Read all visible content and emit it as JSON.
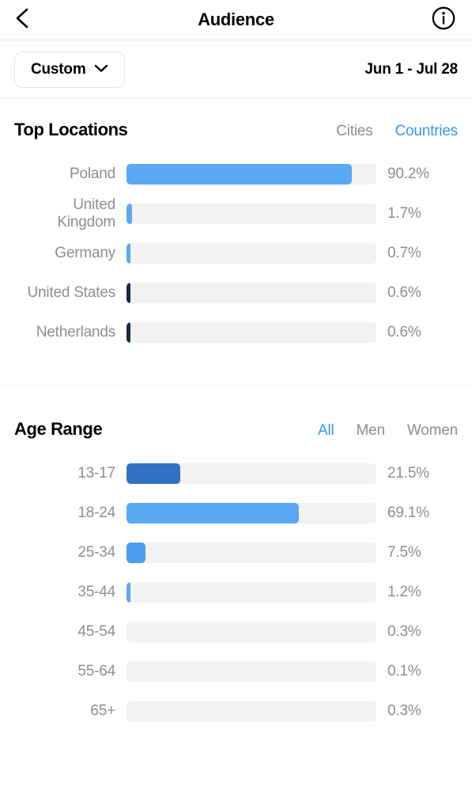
{
  "navbar": {
    "back_icon": "chevron-left-icon",
    "title": "Audience",
    "info_icon": "info-circle-icon"
  },
  "date_bar": {
    "preset_label": "Custom",
    "caret_icon": "chevron-down-icon",
    "range": "Jun 1 - Jul 28"
  },
  "top_locations": {
    "title": "Top Locations",
    "tabs": [
      {
        "label": "Cities",
        "active": false
      },
      {
        "label": "Countries",
        "active": true
      }
    ]
  },
  "age_range": {
    "title": "Age Range",
    "tabs": [
      {
        "label": "All",
        "active": true
      },
      {
        "label": "Men",
        "active": false
      },
      {
        "label": "Women",
        "active": false
      }
    ]
  },
  "colors": {
    "accent_blue": "#3897f0",
    "bar_light_blue": "#5aa9f2",
    "bar_dark_blue": "#2f72c4",
    "bar_navy": "#16294b",
    "bar_track": "#f2f2f2",
    "muted_text": "#8e8e8e"
  },
  "chart_data": [
    {
      "type": "bar",
      "title": "Top Locations",
      "orientation": "horizontal",
      "unit": "%",
      "xlabel": "",
      "ylabel": "",
      "xlim": [
        0,
        100
      ],
      "grid": false,
      "legend": false,
      "active_tab": "Countries",
      "categories": [
        "Poland",
        "United Kingdom",
        "Germany",
        "United States",
        "Netherlands"
      ],
      "values": [
        90.2,
        1.7,
        0.7,
        0.6,
        0.6
      ],
      "value_labels": [
        "90.2%",
        "1.7%",
        "0.7%",
        "0.6%",
        "0.6%"
      ],
      "bar_colors": [
        "#5aa9f2",
        "#5aa9f2",
        "#5aa9f2",
        "#16294b",
        "#16294b"
      ],
      "bar_widths_pct": [
        90.2,
        2.2,
        1.6,
        1.6,
        1.6
      ]
    },
    {
      "type": "bar",
      "title": "Age Range",
      "orientation": "horizontal",
      "unit": "%",
      "xlabel": "",
      "ylabel": "",
      "xlim": [
        0,
        100
      ],
      "grid": false,
      "legend": false,
      "active_tab": "All",
      "categories": [
        "13-17",
        "18-24",
        "25-34",
        "35-44",
        "45-54",
        "55-64",
        "65+"
      ],
      "values": [
        21.5,
        69.1,
        7.5,
        1.2,
        0.3,
        0.1,
        0.3
      ],
      "value_labels": [
        "21.5%",
        "69.1%",
        "7.5%",
        "1.2%",
        "0.3%",
        "0.1%",
        "0.3%"
      ],
      "bar_colors": [
        "#2f72c4",
        "#5aa9f2",
        "#4a9bf0",
        "#5aa9f2",
        "#5aa9f2",
        "#5aa9f2",
        "#5aa9f2"
      ],
      "bar_widths_pct": [
        21.5,
        69.1,
        7.5,
        1.6,
        0,
        0,
        0
      ]
    }
  ]
}
